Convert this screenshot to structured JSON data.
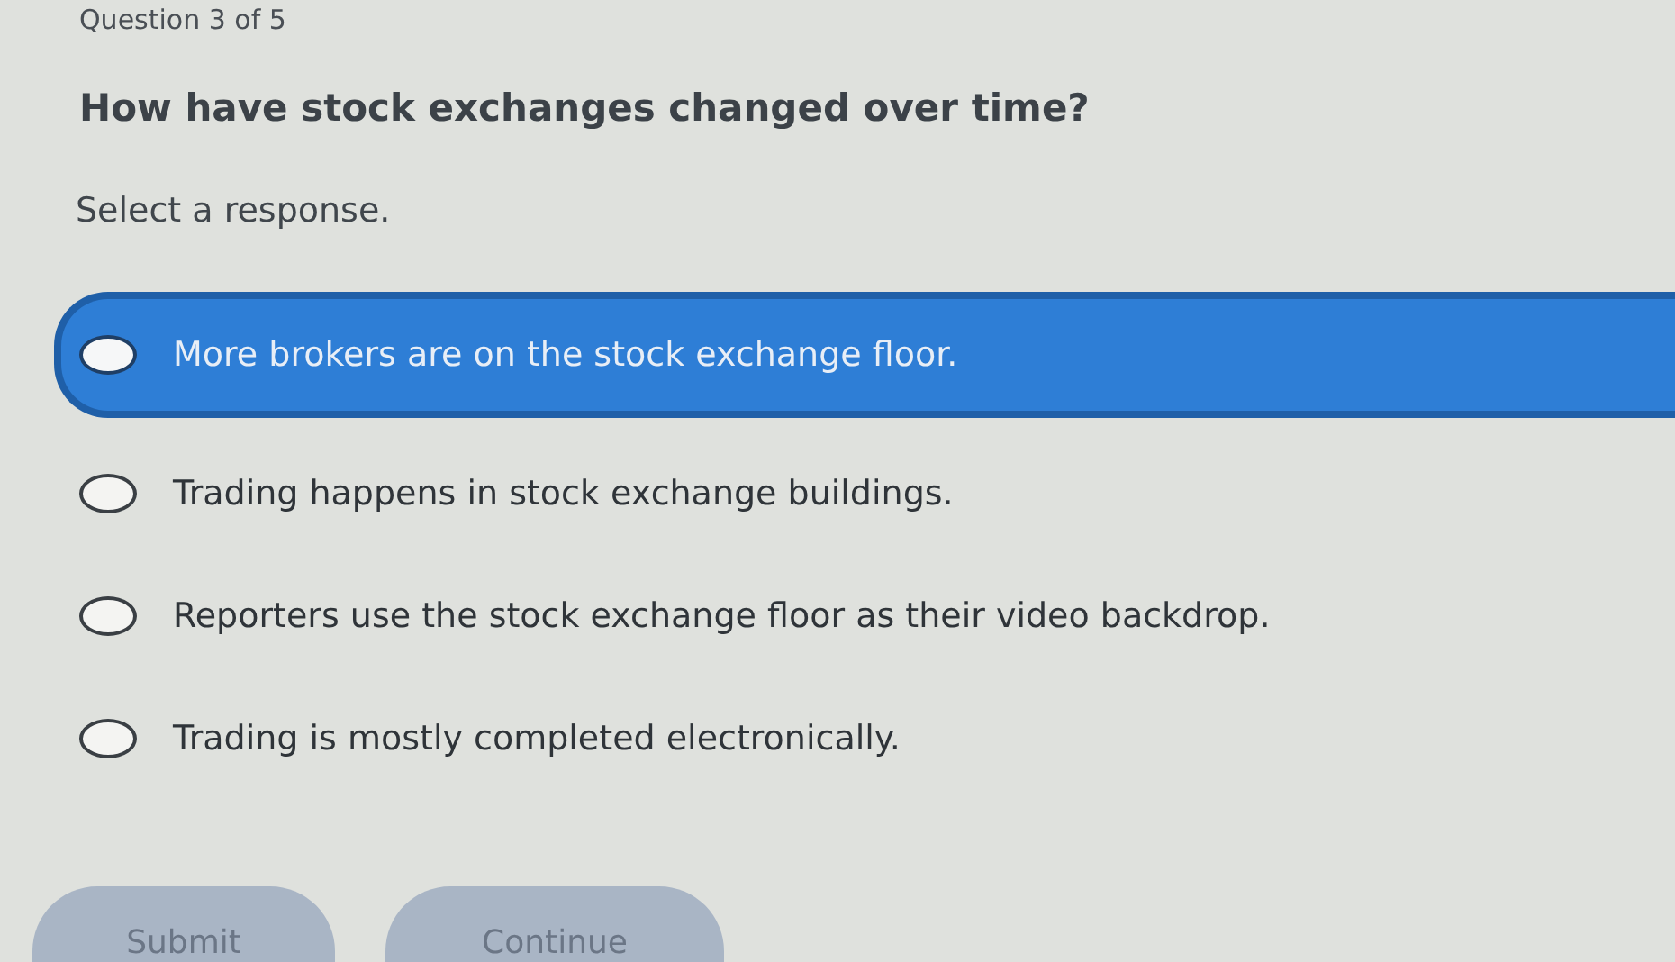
{
  "progress": "Question 3 of 5",
  "question": "How have stock exchanges changed over time?",
  "instruction": "Select a response.",
  "options": [
    {
      "label": "More brokers are on the stock exchange floor.",
      "selected": false,
      "highlighted": true
    },
    {
      "label": "Trading happens in stock exchange buildings.",
      "selected": false,
      "highlighted": false
    },
    {
      "label": "Reporters use the stock exchange floor as their video backdrop.",
      "selected": false,
      "highlighted": false
    },
    {
      "label": "Trading is mostly completed electronically.",
      "selected": false,
      "highlighted": false
    }
  ],
  "buttons": [
    {
      "label": "Submit",
      "disabled": true
    },
    {
      "label": "Continue",
      "disabled": true
    }
  ]
}
